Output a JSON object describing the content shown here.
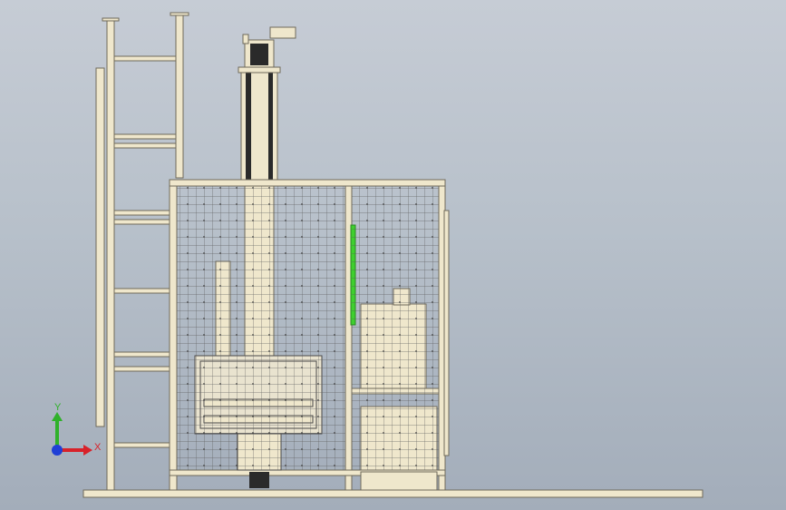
{
  "viewport": {
    "background_top": "#c6ccd5",
    "background_bottom": "#a3adba"
  },
  "model": {
    "frame_color": "#efe7cc",
    "frame_stroke": "#6f6a5a",
    "mesh_color": "#5a5a5a",
    "highlight_color": "#3fcf2f",
    "dark_part_color": "#2a2a2a"
  },
  "triad": {
    "x_label": "X",
    "y_label": "Y",
    "x_color": "#d8222a",
    "y_color": "#2fb12a",
    "z_color": "#1f3fd6"
  }
}
